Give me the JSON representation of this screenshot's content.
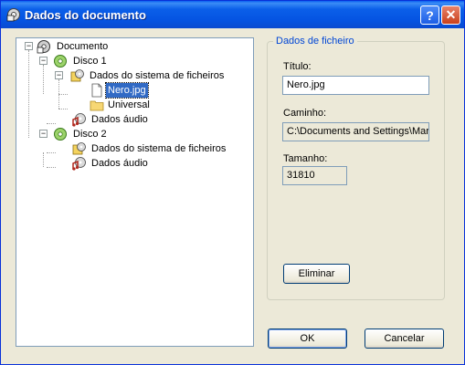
{
  "window": {
    "title": "Dados do documento",
    "help_label": "?",
    "close_label": "✕"
  },
  "tree": {
    "nodes": [
      {
        "label": "Documento",
        "icon": "cd-burner-icon"
      },
      {
        "label": "Disco 1",
        "icon": "disc-icon"
      },
      {
        "label": "Dados do sistema de ficheiros",
        "icon": "filesystem-icon"
      },
      {
        "label": "Nero.jpg",
        "icon": "file-icon",
        "selected": true
      },
      {
        "label": "Universal",
        "icon": "folder-icon"
      },
      {
        "label": "Dados áudio",
        "icon": "audio-data-icon"
      },
      {
        "label": "Disco 2",
        "icon": "disc-icon"
      },
      {
        "label": "Dados do sistema de ficheiros",
        "icon": "filesystem-icon"
      },
      {
        "label": "Dados áudio",
        "icon": "audio-data-icon"
      }
    ],
    "expander_symbol": "−"
  },
  "file_group": {
    "title": "Dados de ficheiro",
    "title_label": "Título:",
    "title_value": "Nero.jpg",
    "path_label": "Caminho:",
    "path_value": "C:\\Documents and Settings\\Mar",
    "size_label": "Tamanho:",
    "size_value": "31810",
    "delete_button": "Eliminar"
  },
  "buttons": {
    "ok": "OK",
    "cancel": "Cancelar"
  },
  "colors": {
    "accent": "#0046d5",
    "selection": "#316ac5",
    "titlebar": "#0554e2",
    "dialog_bg": "#ece9d8"
  }
}
